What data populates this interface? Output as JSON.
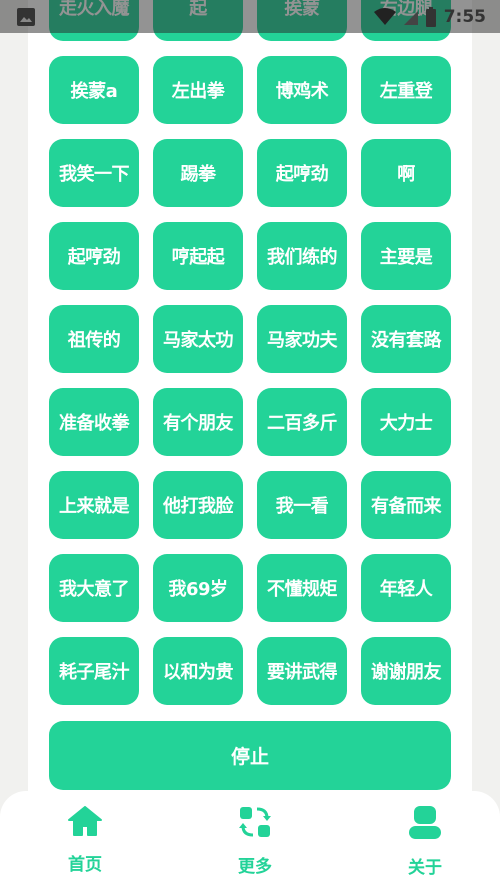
{
  "status_bar": {
    "time": "7:55"
  },
  "buttons": [
    "走火入魔",
    "起",
    "挨蒙",
    "右边腿",
    "挨蒙a",
    "左出拳",
    "博鸡术",
    "左重登",
    "我笑一下",
    "踢拳",
    "起哼劲",
    "啊",
    "起哼劲",
    "哼起起",
    "我们练的",
    "主要是",
    "祖传的",
    "马家太功",
    "马家功夫",
    "没有套路",
    "准备收拳",
    "有个朋友",
    "二百多斤",
    "大力士",
    "上来就是",
    "他打我脸",
    "我一看",
    "有备而来",
    "我大意了",
    "我69岁",
    "不懂规矩",
    "年轻人",
    "耗子尾汁",
    "以和为贵",
    "要讲武得",
    "谢谢朋友"
  ],
  "stop_label": "停止",
  "nav": {
    "home": "首页",
    "more": "更多",
    "about": "关于"
  },
  "colors": {
    "accent": "#23d398"
  }
}
